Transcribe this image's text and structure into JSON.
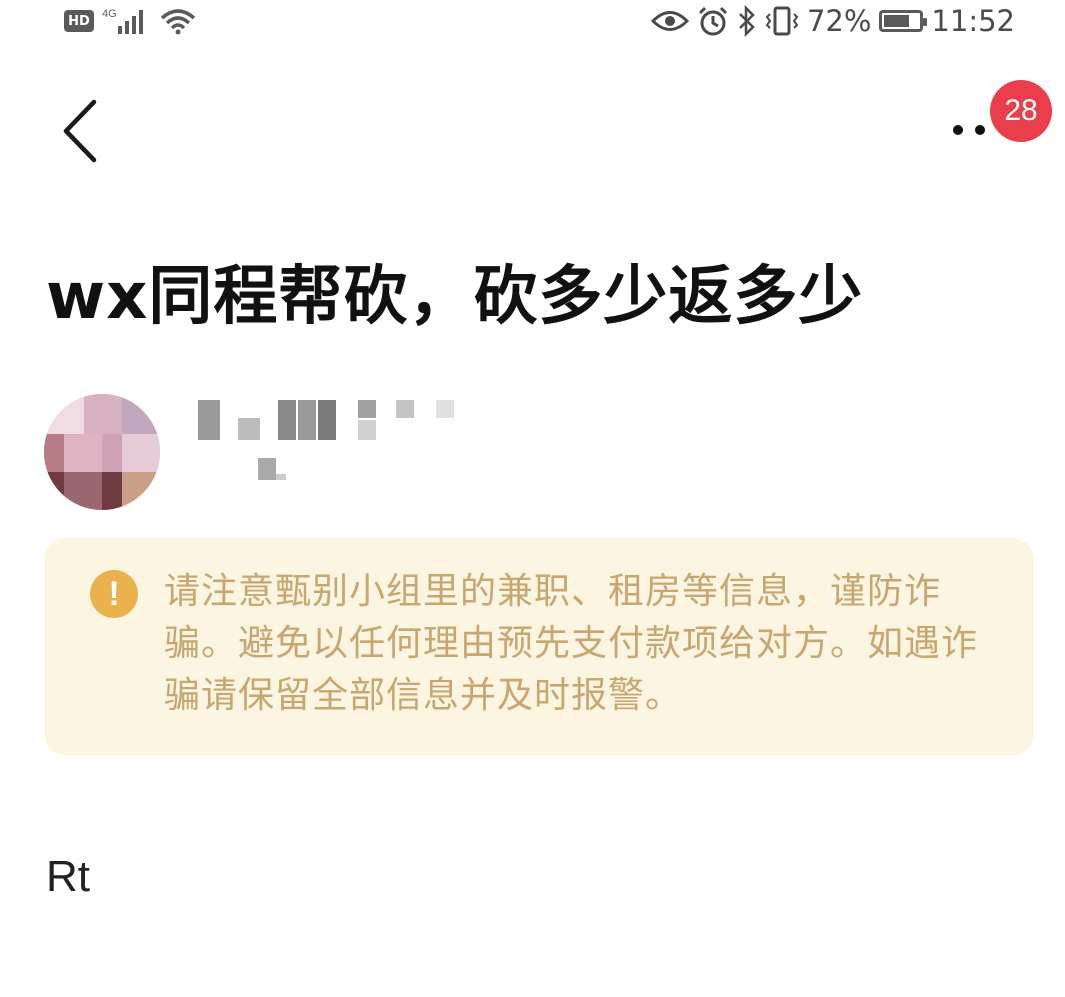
{
  "status_bar": {
    "hd_label": "HD",
    "network_label": "4G",
    "battery_text": "72%",
    "battery_level": 0.72,
    "time": "11:52",
    "icons": [
      "signal-icon",
      "wifi-icon",
      "eye-icon",
      "alarm-icon",
      "bluetooth-icon",
      "vibrate-icon",
      "battery-icon"
    ]
  },
  "nav": {
    "back_icon": "chevron-left-icon",
    "more_icon": "more-dots-icon",
    "badge_count": "28"
  },
  "post": {
    "title": "wx同程帮砍，砍多少返多少",
    "body": "Rt"
  },
  "notice": {
    "icon": "exclamation-circle-icon",
    "text": "请注意甄别小组里的兼职、租房等信息，谨防诈骗。避免以任何理由预先支付款项给对方。如遇诈骗请保留全部信息并及时报警。"
  },
  "colors": {
    "badge": "#ea3e4c",
    "notice_bg": "#fcf5e2",
    "notice_text": "#c8a66f",
    "warn_icon": "#eab14c"
  }
}
